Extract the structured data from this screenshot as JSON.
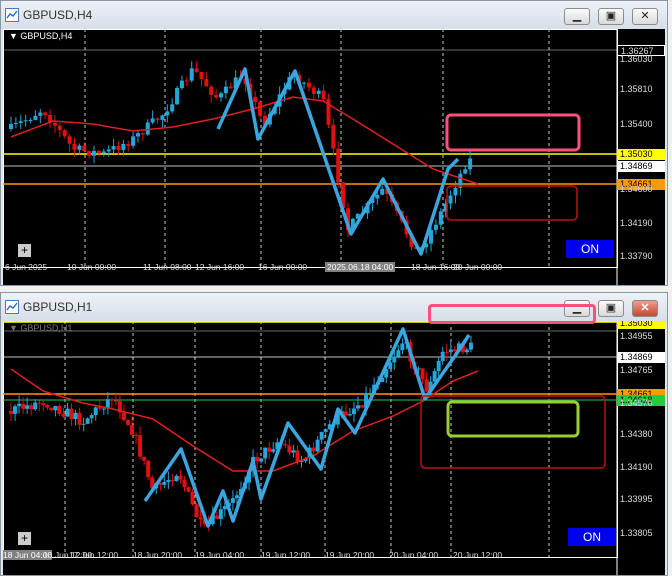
{
  "windows": [
    {
      "title": "GBPUSD,H4",
      "symbol_label": "GBPUSD,H4",
      "price_labels": [
        {
          "text": "1.36267",
          "style": "normal"
        },
        {
          "text": "1.36030",
          "style": "axis"
        },
        {
          "text": "1.35810",
          "style": "axis"
        },
        {
          "text": "1.35400",
          "style": "axis"
        },
        {
          "text": "1.35030",
          "style": "yellow"
        },
        {
          "text": "1.34869",
          "style": "white"
        },
        {
          "text": "1.34661",
          "style": "orange"
        },
        {
          "text": "1.34600",
          "style": "axis"
        },
        {
          "text": "1.34190",
          "style": "axis"
        },
        {
          "text": "1.33790",
          "style": "axis"
        }
      ],
      "time_labels": [
        "6 Jun 2025",
        "10 Jun 00:00",
        "11 Jun 08:00",
        "12 Jun 16:00",
        "16 Jun 00:00",
        "2025.06.18 04:00",
        "18 Jun 16:00",
        "20 Jun 00:00"
      ],
      "highlight_time": "2025.06.18 04:00",
      "on_label": "ON",
      "plus_label": "+"
    },
    {
      "title": "GBPUSD,H1",
      "symbol_label": "GBPUSD,H1",
      "price_labels": [
        {
          "text": "1.35030",
          "style": "yellow"
        },
        {
          "text": "1.34955",
          "style": "axis"
        },
        {
          "text": "1.34869",
          "style": "white"
        },
        {
          "text": "1.34765",
          "style": "axis"
        },
        {
          "text": "1.34661",
          "style": "orange"
        },
        {
          "text": "1.34618",
          "style": "green"
        },
        {
          "text": "1.34570",
          "style": "axis"
        },
        {
          "text": "1.34380",
          "style": "axis"
        },
        {
          "text": "1.34190",
          "style": "axis"
        },
        {
          "text": "1.33995",
          "style": "axis"
        },
        {
          "text": "1.33805",
          "style": "axis"
        }
      ],
      "time_labels": [
        "18 Jun 04:00",
        "16 Jun 12:00",
        "17 Jun 12:00",
        "18 Jun 20:00",
        "19 Jun 04:00",
        "19 Jun 12:00",
        "19 Jun 20:00",
        "20 Jun 04:00",
        "20 Jun 12:00"
      ],
      "on_label": "ON",
      "plus_label": "+"
    }
  ],
  "colors": {
    "bull": "#26a6d8",
    "bear": "#e01010",
    "ma": "#e02020",
    "trend": "#3aa6e0",
    "yellow_line": "#ffff00",
    "orange_line": "#ff9900",
    "pink_box": "#ff4f7a",
    "red_box": "#c01010",
    "green_box": "#9acd32"
  }
}
